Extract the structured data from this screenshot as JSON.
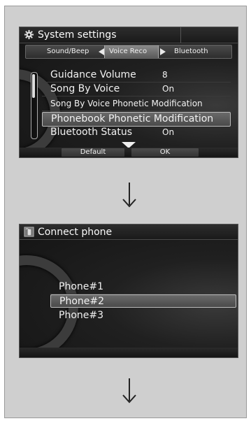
{
  "system_settings": {
    "title": "System settings",
    "icon": "gear-icon",
    "tabs": {
      "left": "Sound/Beep",
      "active": "Voice Reco",
      "right": "Bluetooth"
    },
    "rows": [
      {
        "label": "Guidance Volume",
        "value": "8"
      },
      {
        "label": "Song By Voice",
        "value": "On"
      },
      {
        "label": "Song By Voice Phonetic Modification",
        "value": ""
      },
      {
        "label": "Phonebook Phonetic Modification",
        "value": ""
      },
      {
        "label": "Bluetooth Status",
        "value": "On"
      }
    ],
    "softkeys": {
      "default": "Default",
      "ok": "OK"
    }
  },
  "connect_phone": {
    "title": "Connect phone",
    "icon": "phone-icon",
    "phones": [
      "Phone#1",
      "Phone#2",
      "Phone#3"
    ]
  },
  "arrows": [
    "down-arrow",
    "down-arrow"
  ]
}
